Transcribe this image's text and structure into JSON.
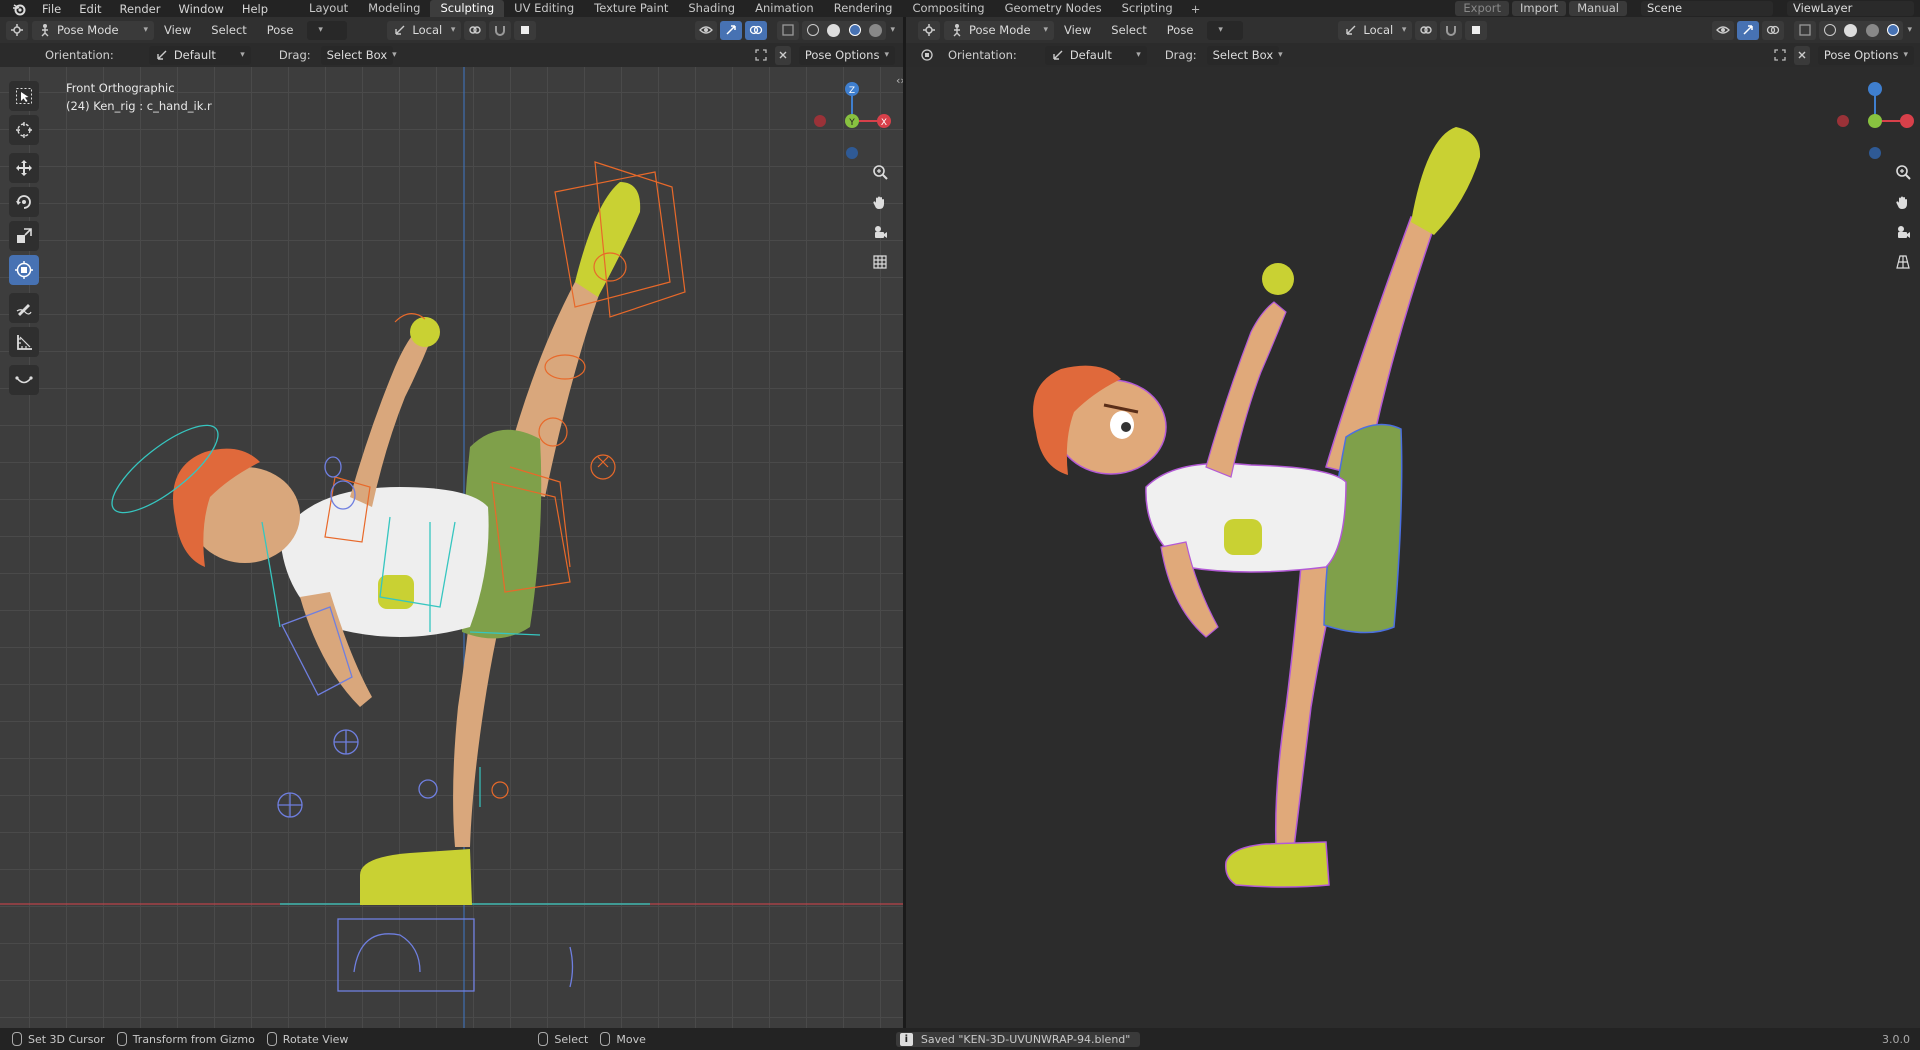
{
  "menu": [
    "File",
    "Edit",
    "Render",
    "Window",
    "Help"
  ],
  "workspaces": [
    {
      "label": "Layout",
      "active": false
    },
    {
      "label": "Modeling",
      "active": false
    },
    {
      "label": "Sculpting",
      "active": true
    },
    {
      "label": "UV Editing",
      "active": false
    },
    {
      "label": "Texture Paint",
      "active": false
    },
    {
      "label": "Shading",
      "active": false
    },
    {
      "label": "Animation",
      "active": false
    },
    {
      "label": "Rendering",
      "active": false
    },
    {
      "label": "Compositing",
      "active": false
    },
    {
      "label": "Geometry Nodes",
      "active": false
    },
    {
      "label": "Scripting",
      "active": false
    }
  ],
  "topright": {
    "export": "Export",
    "import": "Import",
    "manual": "Manual",
    "scene": "Scene",
    "view_layer": "ViewLayer"
  },
  "left": {
    "mode": "Pose Mode",
    "menus": [
      "View",
      "Select",
      "Pose"
    ],
    "transform": "Local",
    "orientation_label": "Orientation:",
    "orientation_value": "Default",
    "drag_label": "Drag:",
    "drag_value": "Select Box",
    "pose_options": "Pose Options",
    "view_name": "Front Orthographic",
    "object_info": "(24) Ken_rig : c_hand_ik.r"
  },
  "right": {
    "mode": "Pose Mode",
    "menus": [
      "View",
      "Select",
      "Pose"
    ],
    "transform": "Local",
    "orientation_label": "Orientation:",
    "orientation_value": "Default",
    "drag_label": "Drag:",
    "drag_value": "Select Box",
    "pose_options": "Pose Options"
  },
  "gizmo": {
    "z": "Z",
    "y": "Y",
    "x": "X"
  },
  "tools": [
    "select-box-icon",
    "cursor-icon",
    "move-icon",
    "rotate-icon",
    "scale-icon",
    "transform-icon",
    "annotate-icon",
    "measure-icon",
    "relax-icon"
  ],
  "status": {
    "set_cursor": "Set 3D Cursor",
    "transform_gizmo": "Transform from Gizmo",
    "rotate_view": "Rotate View",
    "select": "Select",
    "move": "Move",
    "saved": "Saved \"KEN-3D-UVUNWRAP-94.blend\"",
    "version": "3.0.0"
  },
  "colors": {
    "accent": "#4772b3",
    "x_axis": "#d8404a",
    "y_axis": "#88c240",
    "z_axis": "#3f7fcf",
    "bone_orange": "#e8692a",
    "bone_cyan": "#36c6c0",
    "shorts": "#7fa04a",
    "shoes": "#c9d133"
  }
}
